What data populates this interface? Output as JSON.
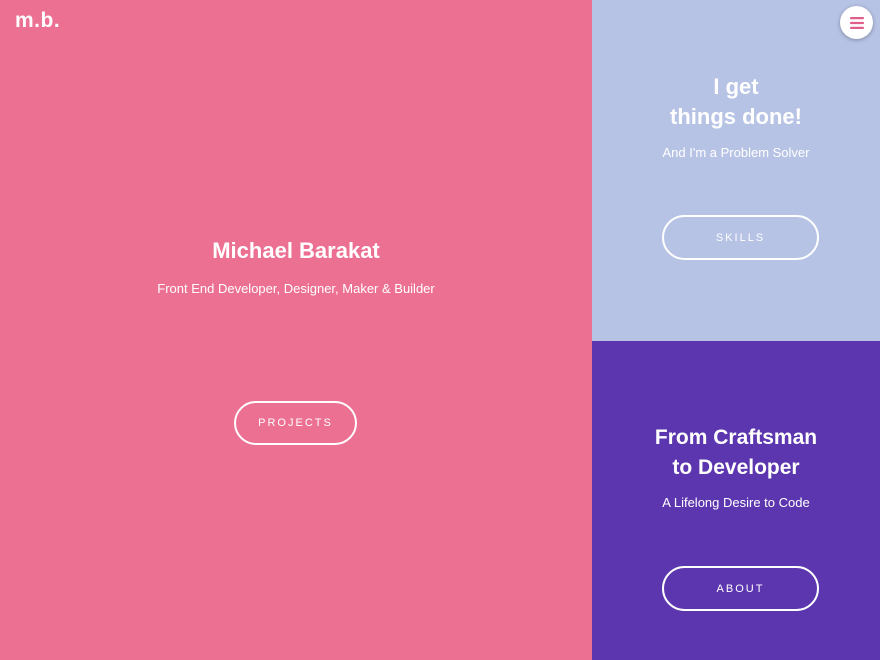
{
  "logo": "m.b.",
  "menu": {
    "icon": "hamburger-icon",
    "accent": "#e0608a"
  },
  "colors": {
    "main": "#ec7092",
    "skills": "#b7c3e5",
    "about": "#5c36ae"
  },
  "main": {
    "title": "Michael Barakat",
    "subtitle": "Front End Developer, Designer, Maker & Builder",
    "button": "PROJECTS"
  },
  "skills": {
    "title_line1": "I get",
    "title_line2": "things done!",
    "subtitle": "And I'm a Problem Solver",
    "button": "SKILLS"
  },
  "about": {
    "title_line1": "From Craftsman",
    "title_line2": "to Developer",
    "subtitle": "A Lifelong Desire to Code",
    "button": "ABOUT"
  }
}
